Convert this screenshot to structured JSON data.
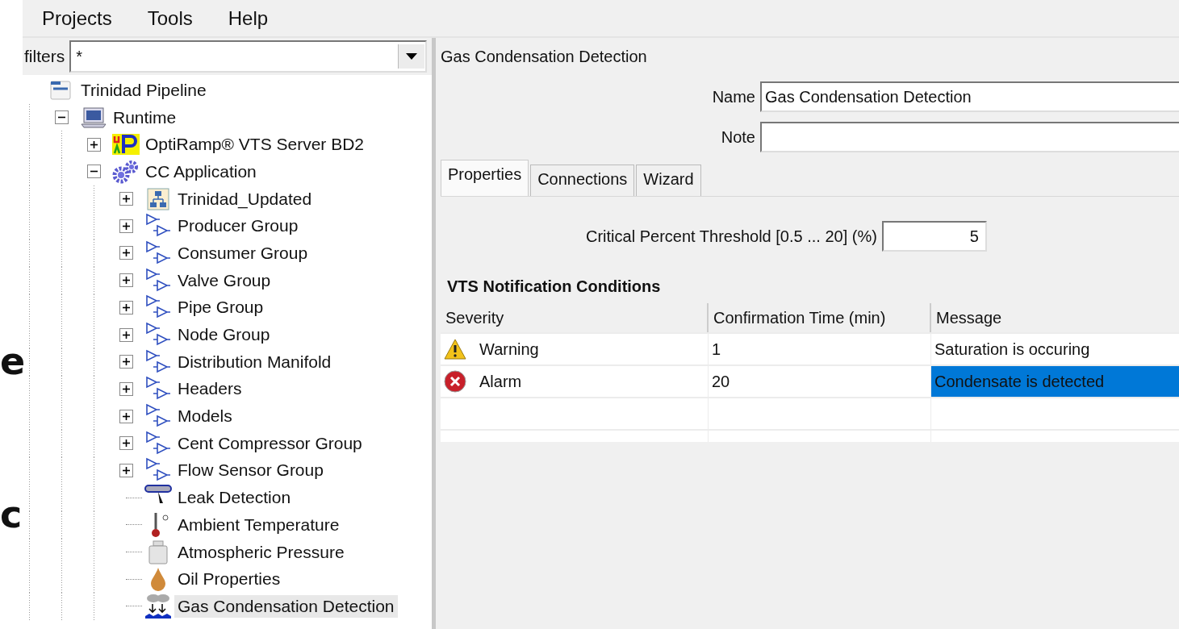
{
  "side_fragments": [
    "e",
    "c"
  ],
  "menu": [
    "Projects",
    "Tools",
    "Help"
  ],
  "filters": {
    "label": "filters",
    "value": "*"
  },
  "tree": [
    {
      "label": "Trinidad Pipeline",
      "kind": "document",
      "selected": false,
      "children": [
        {
          "label": "Runtime",
          "kind": "computer",
          "expanded": true,
          "selected": false,
          "children": [
            {
              "label": "OptiRamp® VTS Server BD2",
              "kind": "server",
              "expanded": false,
              "selected": false
            },
            {
              "label": "CC Application",
              "kind": "gears",
              "expanded": true,
              "selected": false,
              "children": [
                {
                  "label": "Trinidad_Updated",
                  "kind": "network",
                  "expanded": false,
                  "selected": false
                },
                {
                  "label": "Producer Group",
                  "kind": "group",
                  "expanded": false,
                  "selected": false
                },
                {
                  "label": "Consumer Group",
                  "kind": "group",
                  "expanded": false,
                  "selected": false
                },
                {
                  "label": "Valve Group",
                  "kind": "group",
                  "expanded": false,
                  "selected": false
                },
                {
                  "label": "Pipe Group",
                  "kind": "group",
                  "expanded": false,
                  "selected": false
                },
                {
                  "label": "Node Group",
                  "kind": "group",
                  "expanded": false,
                  "selected": false
                },
                {
                  "label": "Distribution Manifold",
                  "kind": "group",
                  "expanded": false,
                  "selected": false
                },
                {
                  "label": "Headers",
                  "kind": "group",
                  "expanded": false,
                  "selected": false
                },
                {
                  "label": "Models",
                  "kind": "group",
                  "expanded": false,
                  "selected": false
                },
                {
                  "label": "Cent Compressor Group",
                  "kind": "group",
                  "expanded": false,
                  "selected": false
                },
                {
                  "label": "Flow Sensor Group",
                  "kind": "group",
                  "expanded": false,
                  "selected": false
                },
                {
                  "label": "Leak Detection",
                  "kind": "pipe",
                  "selected": false
                },
                {
                  "label": "Ambient Temperature",
                  "kind": "thermometer",
                  "selected": false
                },
                {
                  "label": "Atmospheric Pressure",
                  "kind": "weight",
                  "selected": false
                },
                {
                  "label": "Oil Properties",
                  "kind": "drop",
                  "selected": false
                },
                {
                  "label": "Gas Condensation Detection",
                  "kind": "condensation",
                  "selected": true
                }
              ]
            }
          ]
        }
      ]
    }
  ],
  "detail": {
    "title": "Gas Condensation Detection",
    "fields": [
      {
        "label": "Name",
        "value": "Gas Condensation Detection"
      },
      {
        "label": "Note"
      }
    ],
    "tabs": [
      {
        "label": "Properties",
        "selected": true
      },
      {
        "label": "Connections",
        "selected": false
      },
      {
        "label": "Wizard",
        "selected": false
      }
    ],
    "threshold": {
      "label": "Critical Percent Threshold [0.5 ... 20] (%)",
      "value": "5"
    },
    "section_title": "VTS Notification Conditions",
    "table": {
      "columns": [
        "Severity",
        "Confirmation Time (min)",
        "Message"
      ],
      "rows": [
        {
          "kind": "warning",
          "severity": "Warning",
          "time": "1",
          "message": "Saturation is occuring",
          "selected": false
        },
        {
          "kind": "alarm",
          "severity": "Alarm",
          "time": "20",
          "message": "Condensate is detected",
          "selected": true
        }
      ]
    }
  }
}
